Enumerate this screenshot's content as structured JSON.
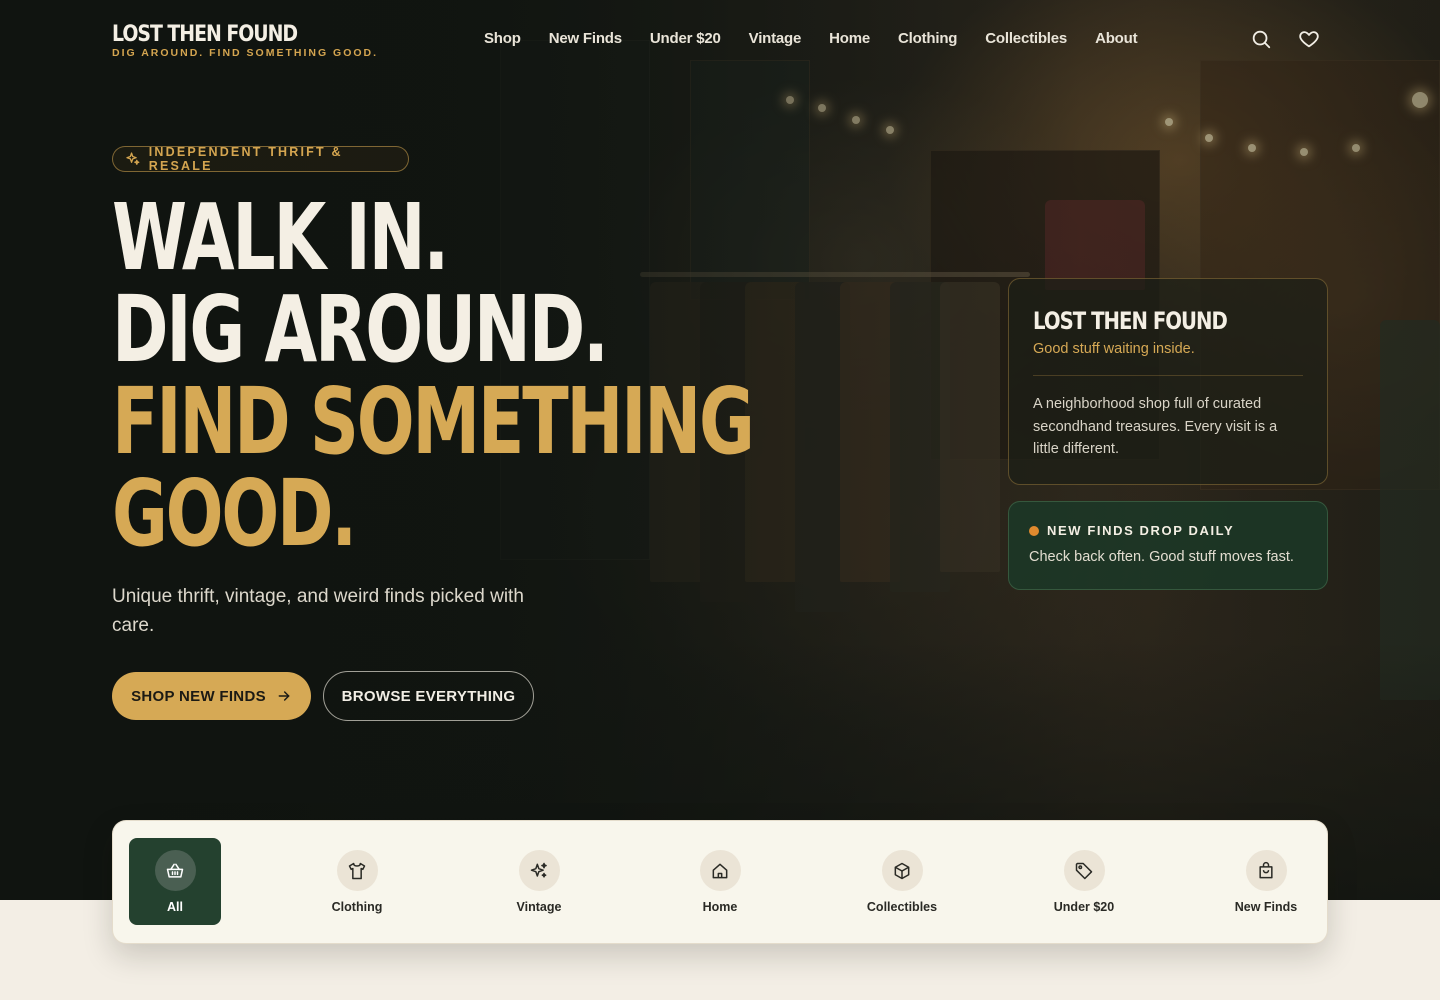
{
  "brand": {
    "name": "LOST THEN FOUND",
    "tagline": "DIG AROUND. FIND SOMETHING GOOD."
  },
  "nav": {
    "links": [
      "Shop",
      "New Finds",
      "Under $20",
      "Vintage",
      "Home",
      "Clothing",
      "Collectibles",
      "About"
    ],
    "icons": [
      "search-icon",
      "heart-icon"
    ]
  },
  "hero": {
    "pill": "INDEPENDENT THRIFT & RESALE",
    "headline": [
      "WALK IN.",
      "DIG AROUND.",
      "FIND SOMETHING",
      "GOOD."
    ],
    "subtitle": "Unique thrift, vintage, and weird finds picked with care.",
    "primary_button": "SHOP NEW FINDS",
    "secondary_button": "BROWSE EVERYTHING"
  },
  "info_card": {
    "title": "LOST THEN FOUND",
    "subtitle": "Good stuff waiting inside.",
    "body": "A neighborhood shop full of curated secondhand treasures. Every visit is a little different."
  },
  "notice": {
    "title": "NEW FINDS DROP DAILY",
    "body": "Check back often. Good stuff moves fast."
  },
  "categories": [
    {
      "label": "All",
      "icon": "basket-icon",
      "active": true
    },
    {
      "label": "Clothing",
      "icon": "shirt-icon",
      "active": false
    },
    {
      "label": "Vintage",
      "icon": "sparkles-icon",
      "active": false
    },
    {
      "label": "Home",
      "icon": "home-icon",
      "active": false
    },
    {
      "label": "Collectibles",
      "icon": "box-icon",
      "active": false
    },
    {
      "label": "Under $20",
      "icon": "tag-icon",
      "active": false
    },
    {
      "label": "New Finds",
      "icon": "bag-icon",
      "active": false
    }
  ],
  "colors": {
    "accent_gold": "#d6a955",
    "dark_green": "#24412f",
    "cream": "#f8f6ec",
    "notice_dot": "#e08a2e"
  }
}
